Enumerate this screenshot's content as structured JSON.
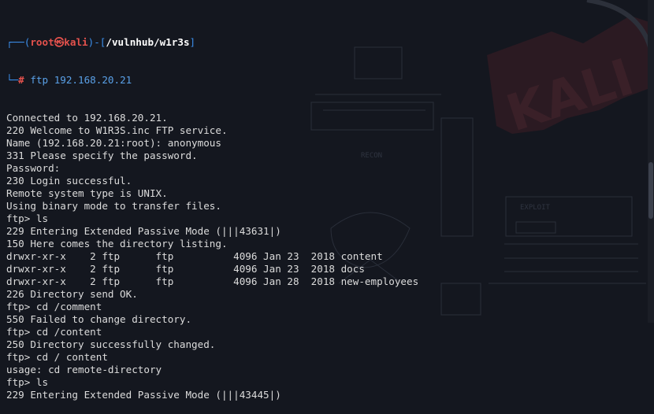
{
  "prompt": {
    "user": "root",
    "skull": "㉿",
    "host": "kali",
    "path": "/vulnhub/w1r3s",
    "hash": "#",
    "command": "ftp 192.168.20.21"
  },
  "output_lines": [
    "Connected to 192.168.20.21.",
    "220 Welcome to W1R3S.inc FTP service.",
    "Name (192.168.20.21:root): anonymous",
    "331 Please specify the password.",
    "Password:",
    "230 Login successful.",
    "Remote system type is UNIX.",
    "Using binary mode to transfer files.",
    "ftp> ls",
    "229 Entering Extended Passive Mode (|||43631|)",
    "150 Here comes the directory listing.",
    "drwxr-xr-x    2 ftp      ftp          4096 Jan 23  2018 content",
    "drwxr-xr-x    2 ftp      ftp          4096 Jan 23  2018 docs",
    "drwxr-xr-x    2 ftp      ftp          4096 Jan 28  2018 new-employees",
    "226 Directory send OK.",
    "ftp> cd /comment",
    "550 Failed to change directory.",
    "ftp> cd /content",
    "250 Directory successfully changed.",
    "ftp> cd / content",
    "usage: cd remote-directory",
    "ftp> ls",
    "229 Entering Extended Passive Mode (|||43445|)"
  ],
  "colors": {
    "background": "#14171f",
    "text": "#dcdcdc",
    "prompt_frame": "#3b8eea",
    "prompt_user": "#e5524d",
    "command": "#5aa1e8"
  },
  "wallpaper": {
    "logo_text": "KALI",
    "labels": [
      "RECON",
      "EXPLOIT"
    ]
  },
  "scrollbar": {
    "position_fraction": 0.61
  }
}
